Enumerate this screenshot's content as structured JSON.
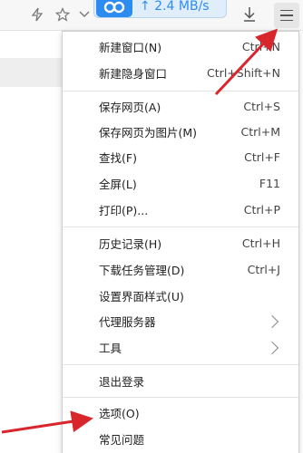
{
  "toolbar": {
    "download_speed": "2.4 MB/s",
    "icons": [
      "lightning-icon",
      "star-icon",
      "chevron-down-icon",
      "download-icon",
      "hamburger-menu-icon"
    ]
  },
  "menu": {
    "items": [
      {
        "label": "新建窗口(N)",
        "shortcut": "Ctrl+N"
      },
      {
        "label": "新建隐身窗口",
        "shortcut": "Ctrl+Shift+N"
      },
      {
        "label": "保存网页(A)",
        "shortcut": "Ctrl+S"
      },
      {
        "label": "保存网页为图片(M)",
        "shortcut": "Ctrl+M"
      },
      {
        "label": "查找(F)",
        "shortcut": "Ctrl+F"
      },
      {
        "label": "全屏(L)",
        "shortcut": "F11"
      },
      {
        "label": "打印(P)...",
        "shortcut": "Ctrl+P"
      },
      {
        "label": "历史记录(H)",
        "shortcut": "Ctrl+H"
      },
      {
        "label": "下载任务管理(D)",
        "shortcut": "Ctrl+J"
      },
      {
        "label": "设置界面样式(U)",
        "shortcut": ""
      },
      {
        "label": "代理服务器",
        "shortcut": ""
      },
      {
        "label": "工具",
        "shortcut": ""
      },
      {
        "label": "退出登录",
        "shortcut": ""
      },
      {
        "label": "选项(O)",
        "shortcut": ""
      },
      {
        "label": "常见问题",
        "shortcut": ""
      }
    ]
  },
  "colors": {
    "annotation_arrow": "#d9262c",
    "speed_accent": "#2d8cf0"
  }
}
